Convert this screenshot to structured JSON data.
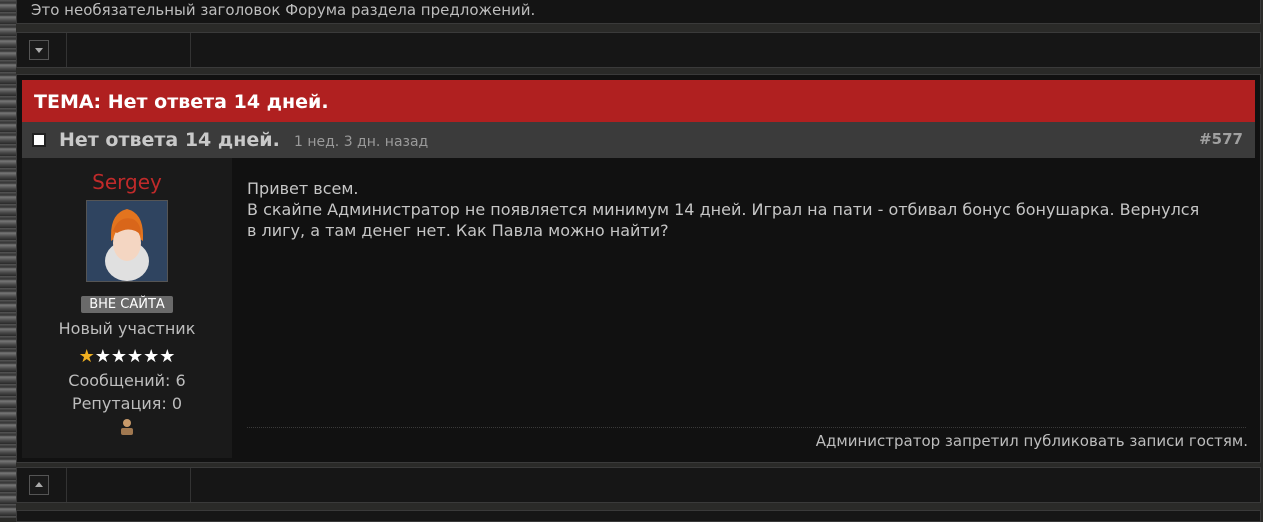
{
  "header": {
    "forum_subtitle": "Это необязательный заголовок Форума раздела предложений."
  },
  "topic": {
    "title": "ТЕМА: Нет ответа 14 дней."
  },
  "post": {
    "title": "Нет ответа 14 дней.",
    "time_ago": "1 нед. 3 дн. назад",
    "number": "#577",
    "lines": [
      "Привет всем.",
      "В скайпе Администратор не появляется минимум 14 дней. Играл на пати - отбивал бонус бонушарка. Вернулся",
      "в лигу, а там денег нет. Как Павла можно найти?"
    ],
    "footer_notice": "Администратор запретил публиковать записи гостям."
  },
  "author": {
    "username": "Sergey",
    "status": "ВНЕ САЙТА",
    "rank": "Новый участник",
    "stars_filled": 1,
    "stars_total": 6,
    "posts": "Сообщений: 6",
    "reputation": "Репутация: 0"
  },
  "icons": {
    "nav_down": "chevron-down-icon",
    "nav_up": "chevron-up-icon",
    "post": "post-icon",
    "star": "star-icon",
    "personal": "person-icon"
  },
  "colors": {
    "topic_header_bg": "#b02020",
    "username": "#c02a2a",
    "star_gold": "#f0b020"
  }
}
